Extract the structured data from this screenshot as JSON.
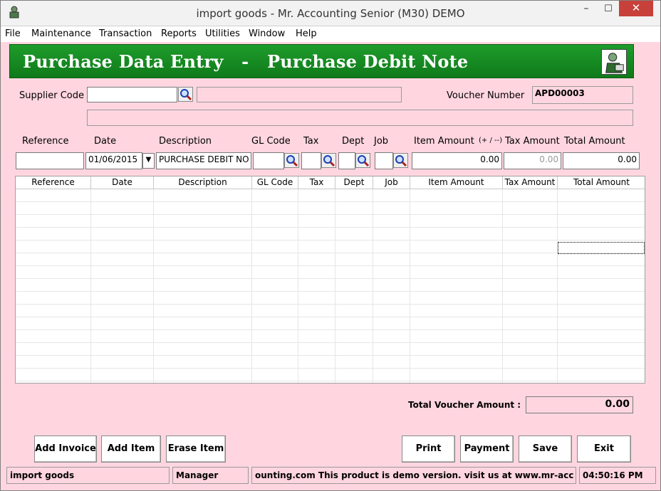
{
  "window": {
    "title": "import goods - Mr. Accounting Senior (M30) DEMO",
    "minimize": "–",
    "maximize": "☐",
    "close": "✕"
  },
  "menu": [
    "File",
    "Maintenance",
    "Transaction",
    "Reports",
    "Utilities",
    "Window",
    "Help"
  ],
  "header": {
    "title": "Purchase Data Entry   -   Purchase Debit Note"
  },
  "form": {
    "supplier_code_label": "Supplier Code",
    "supplier_code": "",
    "supplier_name": "",
    "supplier_address": "",
    "voucher_number_label": "Voucher Number",
    "voucher_number": "APD00003"
  },
  "entry": {
    "labels": {
      "reference": "Reference",
      "date": "Date",
      "description": "Description",
      "gl_code": "GL Code",
      "tax": "Tax",
      "dept": "Dept",
      "job": "Job",
      "item_amount": "Item Amount",
      "plus_minus": "(+ / --)",
      "tax_amount": "Tax Amount",
      "total_amount": "Total Amount"
    },
    "values": {
      "reference": "",
      "date": "01/06/2015",
      "description": "PURCHASE DEBIT NO",
      "gl_code": "",
      "tax": "",
      "dept": "",
      "job": "",
      "item_amount": "0.00",
      "tax_amount": "0.00",
      "total_amount": "0.00"
    }
  },
  "grid": {
    "columns": [
      "Reference",
      "Date",
      "Description",
      "GL Code",
      "Tax",
      "Dept",
      "Job",
      "Item Amount",
      "Tax Amount",
      "Total Amount"
    ]
  },
  "totals": {
    "label": "Total  Voucher Amount :",
    "value": "0.00"
  },
  "buttons": {
    "add_invoice": "Add Invoice",
    "add_item": "Add Item",
    "erase_item": "Erase Item",
    "print": "Print",
    "payment": "Payment",
    "save": "Save",
    "exit": "Exit"
  },
  "status": {
    "company": "import goods",
    "user": "Manager",
    "message": "ounting.com This product is demo version.  visit us at www.mr-acc",
    "time": "04:50:16 PM"
  }
}
